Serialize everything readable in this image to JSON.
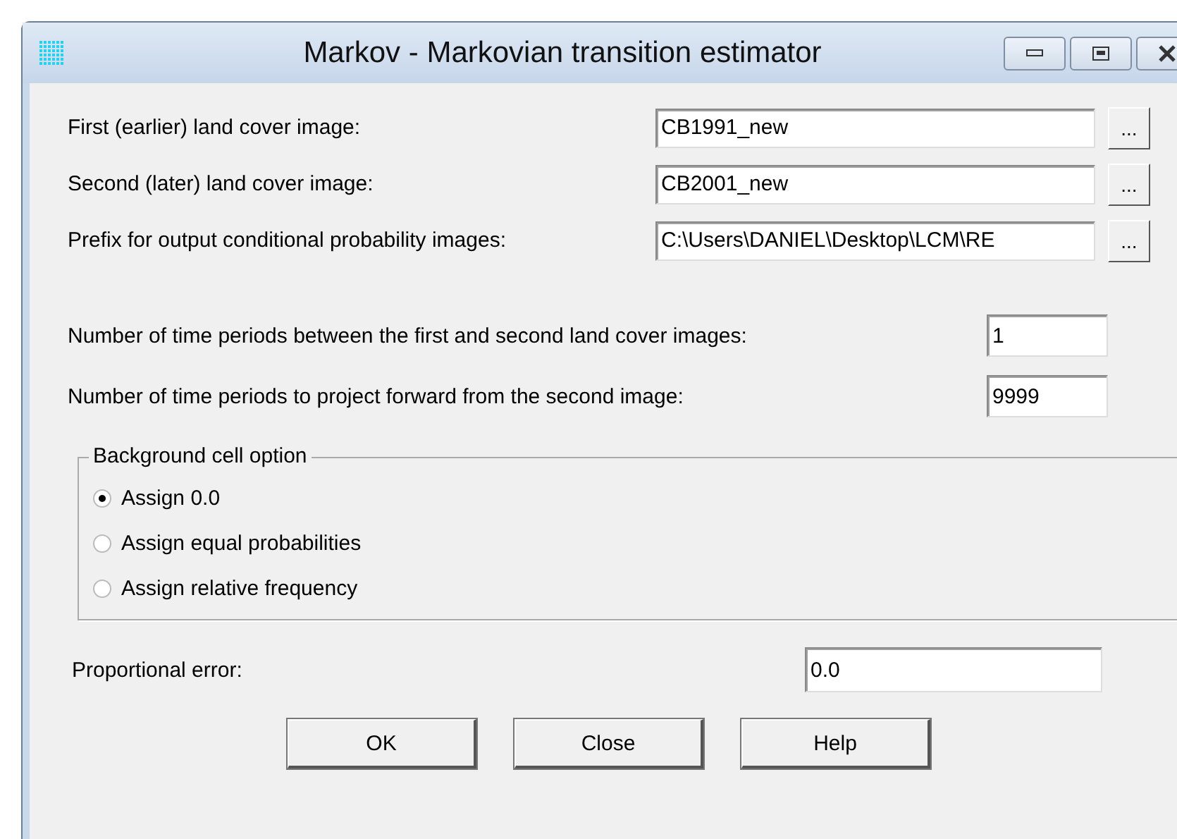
{
  "window": {
    "title": "Markov - Markovian transition estimator"
  },
  "file_fields": [
    {
      "label": "First (earlier) land cover image:",
      "value": "CB1991_new",
      "browse": "..."
    },
    {
      "label": "Second (later) land cover image:",
      "value": "CB2001_new",
      "browse": "..."
    },
    {
      "label": "Prefix for output conditional probability images:",
      "value": "C:\\Users\\DANIEL\\Desktop\\LCM\\RE",
      "browse": "..."
    }
  ],
  "period_fields": [
    {
      "label": "Number of time periods between the first and second land cover images:",
      "value": "1"
    },
    {
      "label": "Number of time periods to project forward from the second image:",
      "value": "9999"
    }
  ],
  "background_option": {
    "title": "Background cell option",
    "options": [
      {
        "label": "Assign 0.0",
        "selected": true
      },
      {
        "label": "Assign equal probabilities",
        "selected": false
      },
      {
        "label": "Assign relative frequency",
        "selected": false
      }
    ]
  },
  "proportional_error": {
    "label": "Proportional error:",
    "value": "0.0"
  },
  "buttons": [
    "OK",
    "Close",
    "Help"
  ]
}
